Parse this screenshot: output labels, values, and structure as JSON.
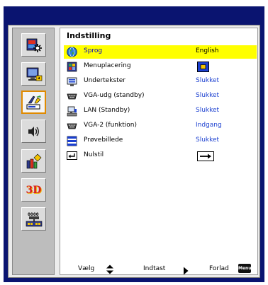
{
  "menu": {
    "title": "Indstilling",
    "items": [
      {
        "label": "Sprog",
        "value": "English",
        "icon": "globe-icon",
        "selected": true
      },
      {
        "label": "Menuplacering",
        "value": "",
        "icon": "menu-location-icon",
        "value_icon": "menu-position-icon"
      },
      {
        "label": "Undertekster",
        "value": "Slukket",
        "icon": "closed-caption-icon"
      },
      {
        "label": "VGA-udg (standby)",
        "value": "Slukket",
        "icon": "vga-out-icon"
      },
      {
        "label": "LAN (Standby)",
        "value": "Slukket",
        "icon": "lan-icon"
      },
      {
        "label": "VGA-2 (funktion)",
        "value": "Indgang",
        "icon": "vga2-icon"
      },
      {
        "label": "Prøvebillede",
        "value": "Slukket",
        "icon": "test-pattern-icon"
      },
      {
        "label": "Nulstil",
        "value": "",
        "icon": "reset-icon",
        "value_icon": "enter-arrow-icon"
      }
    ]
  },
  "sidebar": {
    "items": [
      {
        "name": "image-settings",
        "icon": "image-settings-icon"
      },
      {
        "name": "display",
        "icon": "display-icon"
      },
      {
        "name": "setup",
        "icon": "setup-icon",
        "active": true
      },
      {
        "name": "volume",
        "icon": "volume-icon"
      },
      {
        "name": "options",
        "icon": "options-icon"
      },
      {
        "name": "3d",
        "icon": "3d-icon",
        "label": "3D"
      },
      {
        "name": "lan",
        "icon": "lan-settings-icon",
        "label": "0000"
      }
    ]
  },
  "footer": {
    "select_label": "Vælg",
    "enter_label": "Indtast",
    "exit_label": "Forlad",
    "menu_key_label": "Menu"
  },
  "colors": {
    "frame": "#0a1470",
    "highlight": "#ffff00",
    "value_text": "#1a3fd0",
    "active_border": "#e08a00"
  }
}
